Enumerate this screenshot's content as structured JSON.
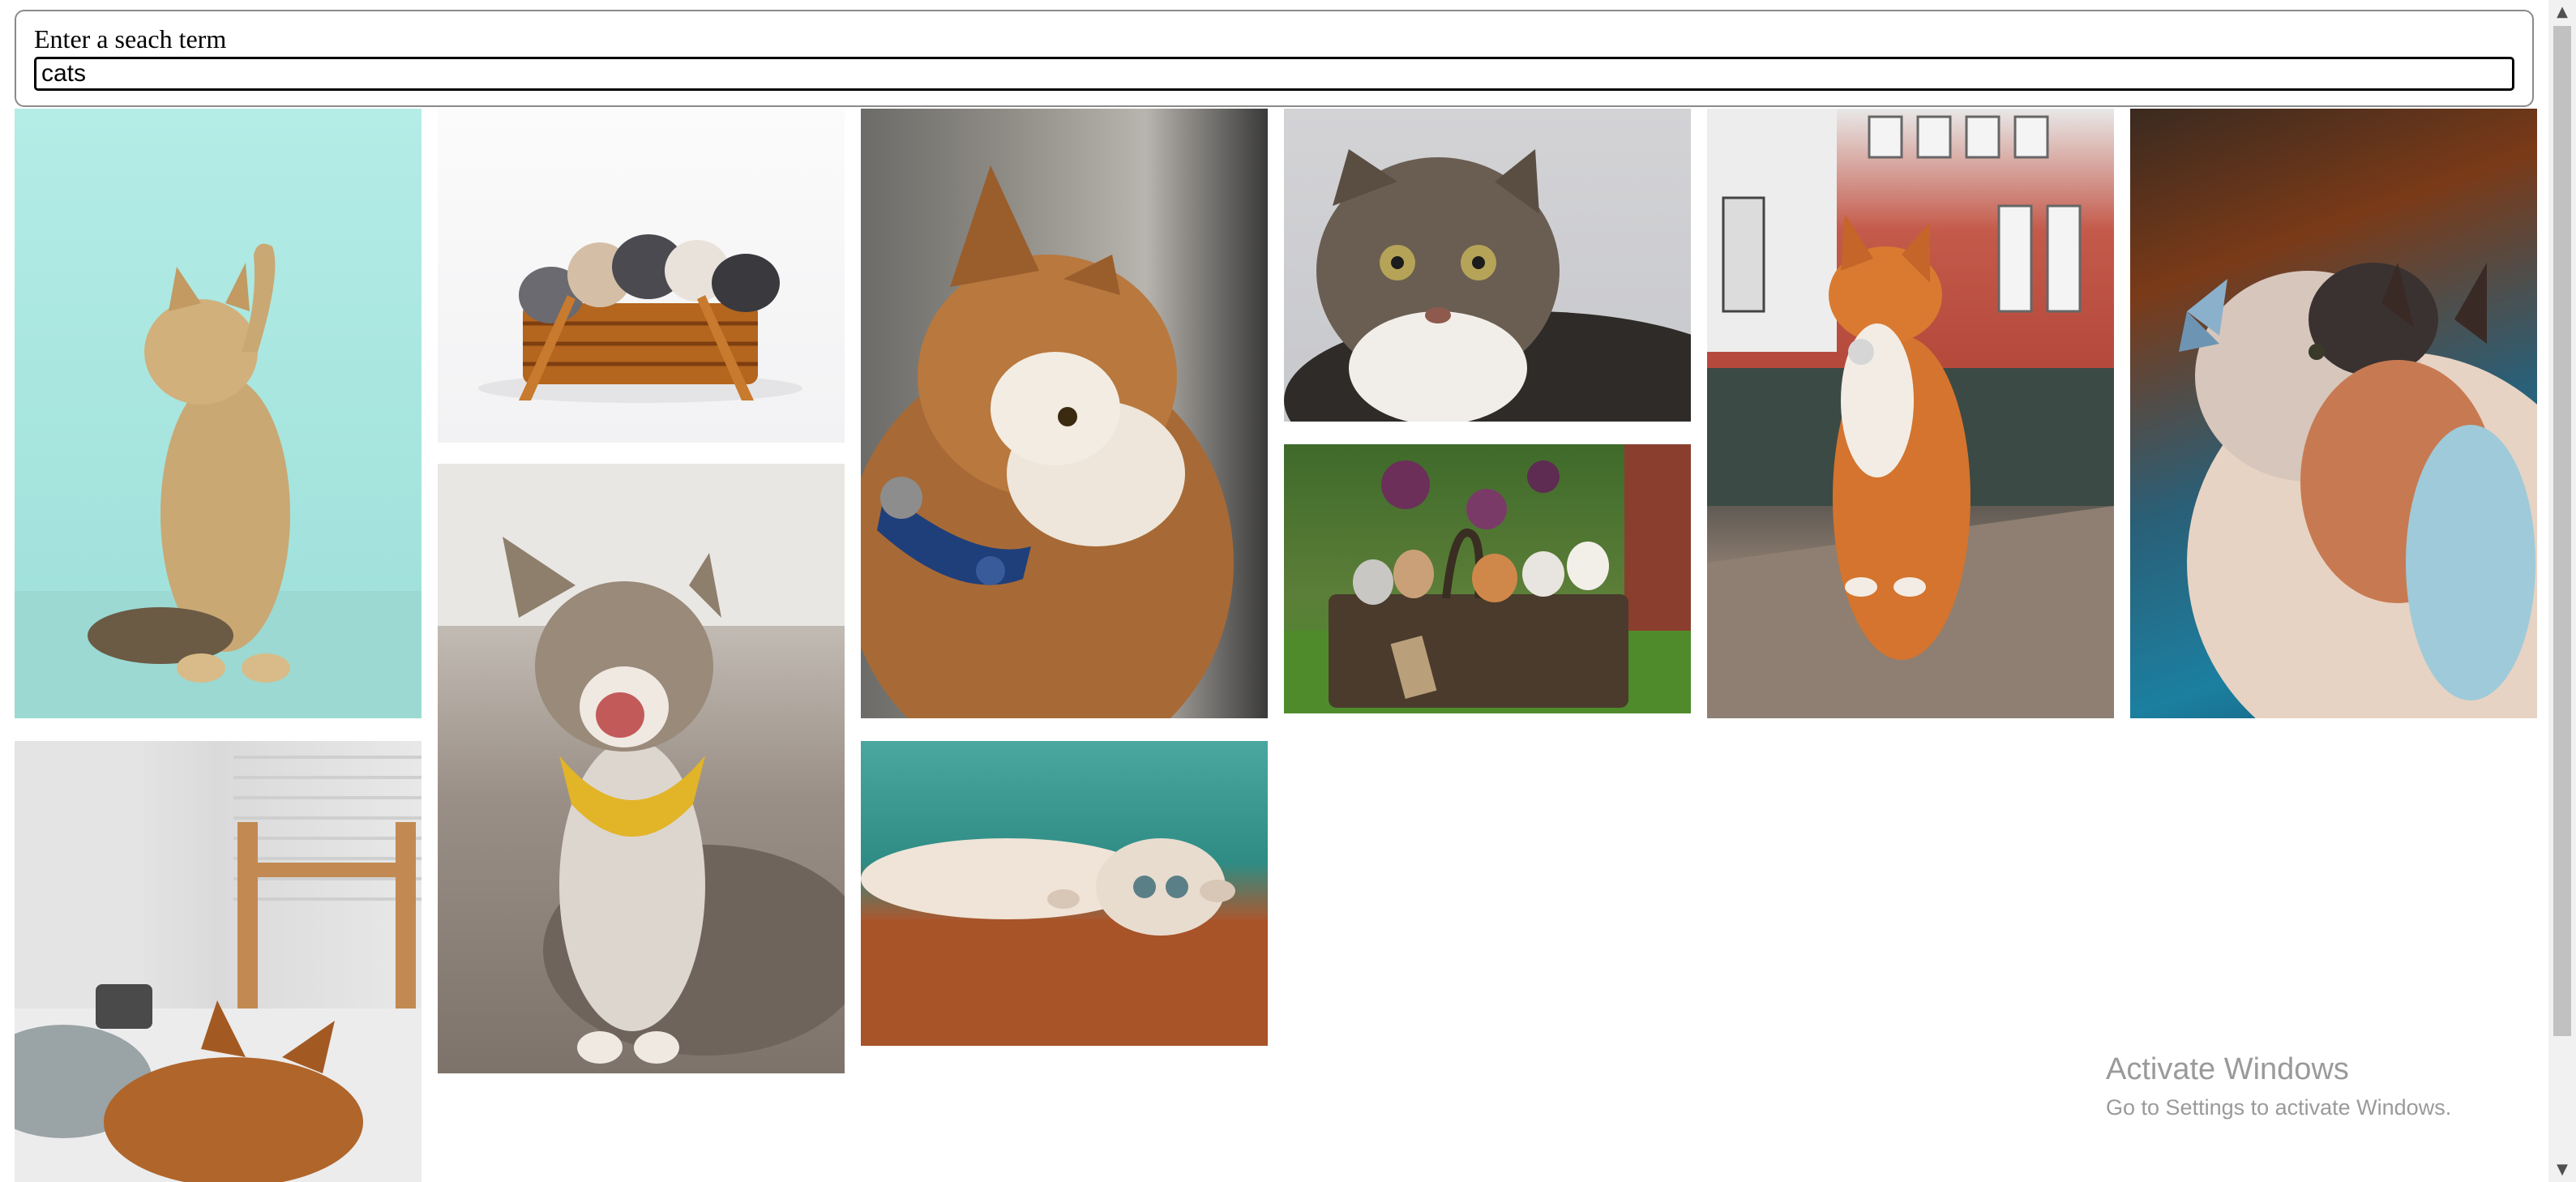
{
  "search": {
    "label": "Enter a seach term",
    "value": "cats"
  },
  "gallery": {
    "images": [
      {
        "subject": "kitten-raising-paw-teal-background"
      },
      {
        "subject": "kittens-in-wicker-basket"
      },
      {
        "subject": "smiling-cat-yellow-bandana"
      },
      {
        "subject": "cat-profile-blue-collar"
      },
      {
        "subject": "kitten-lying-on-wood-floor"
      },
      {
        "subject": "tabby-cat-portrait"
      },
      {
        "subject": "kittens-in-basket-garden"
      },
      {
        "subject": "orange-cat-sitting-on-street"
      },
      {
        "subject": "fluffy-cat-with-butterfly"
      },
      {
        "subject": "cat-sleeping-on-bed"
      }
    ]
  },
  "watermark": {
    "title": "Activate Windows",
    "subtitle": "Go to Settings to activate Windows."
  },
  "scrollbar": {
    "up_icon": "triangle-up-icon",
    "down_icon": "triangle-down-icon"
  }
}
